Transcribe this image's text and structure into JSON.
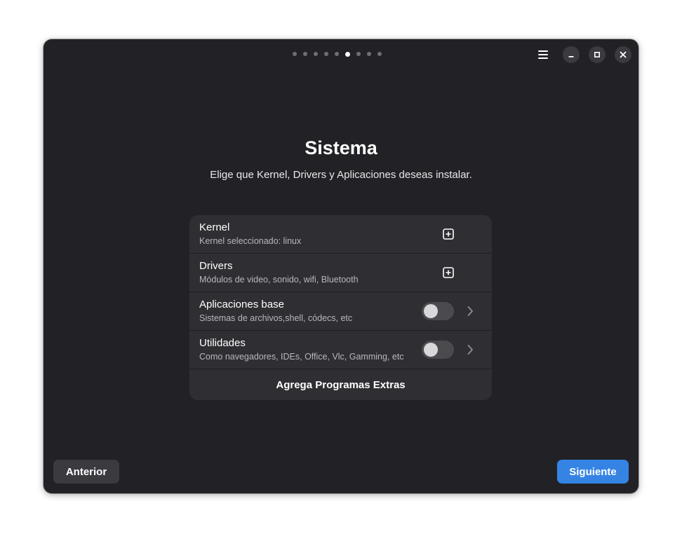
{
  "colors": {
    "window_bg": "#222226",
    "card_bg": "#2f2f33",
    "accent": "#3584e4",
    "button_bg": "#3a3a3f",
    "muted_text": "#b8b8bc"
  },
  "header": {
    "page_indicator": {
      "total": 9,
      "current": 6
    },
    "icons": {
      "menu": "hamburger-menu-icon",
      "minimize": "minimize-icon",
      "maximize": "maximize-icon",
      "close": "close-icon"
    }
  },
  "main": {
    "title": "Sistema",
    "subtitle": "Elige que Kernel, Drivers y Aplicaciones deseas instalar.",
    "rows": [
      {
        "title": "Kernel",
        "subtitle": "Kernel seleccionado: linux",
        "control": "add",
        "icon": "add-box-icon"
      },
      {
        "title": "Drivers",
        "subtitle": "Módulos de video, sonido, wifi, Bluetooth",
        "control": "add",
        "icon": "add-box-icon"
      },
      {
        "title": "Aplicaciones base",
        "subtitle": "Sistemas de archivos,shell, códecs, etc",
        "control": "toggle",
        "toggle_on": false,
        "icon": "chevron-right-icon"
      },
      {
        "title": "Utilidades",
        "subtitle": "Como navegadores, IDEs, Office, Vlc, Gamming, etc",
        "control": "toggle",
        "toggle_on": false,
        "icon": "chevron-right-icon"
      }
    ],
    "extra_button": "Agrega Programas Extras"
  },
  "footer": {
    "prev_label": "Anterior",
    "next_label": "Siguiente"
  }
}
